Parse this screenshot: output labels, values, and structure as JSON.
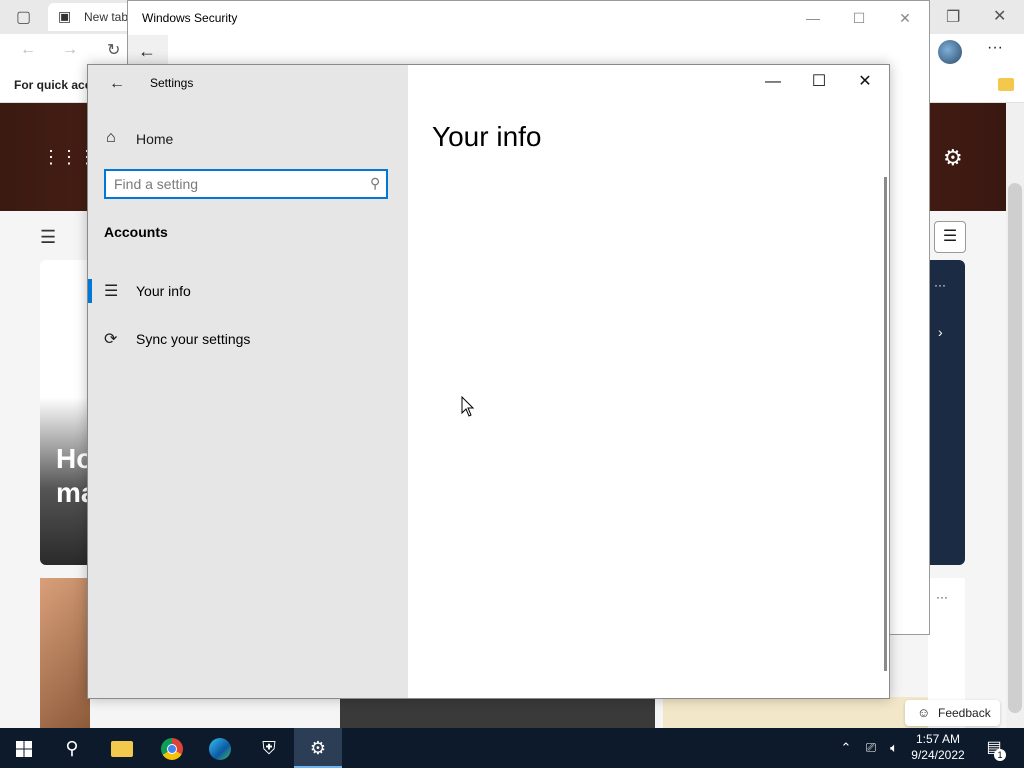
{
  "browser": {
    "tab_title": "New tab",
    "favorites_hint": "For quick acce",
    "card_text": "Ho ma",
    "feedback_label": "Feedback"
  },
  "windows_security": {
    "title": "Windows Security"
  },
  "settings": {
    "app_title": "Settings",
    "home_label": "Home",
    "search_placeholder": "Find a setting",
    "section_title": "Accounts",
    "nav_items": [
      {
        "label": "Your info",
        "icon": "contact-card-icon",
        "selected": true
      },
      {
        "label": "Sync your settings",
        "icon": "sync-icon",
        "selected": false
      }
    ],
    "page_title": "Your info"
  },
  "taskbar": {
    "time": "1:57 AM",
    "date": "9/24/2022",
    "notifications": "1",
    "accent": "#0078d7"
  }
}
